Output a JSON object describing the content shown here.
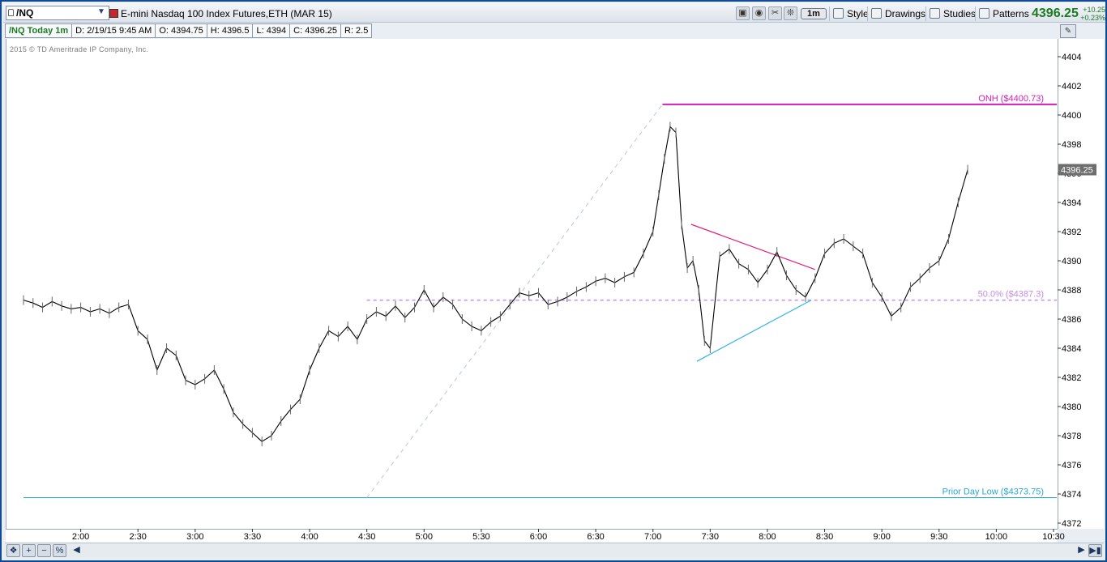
{
  "toolbar": {
    "symbol": "/NQ",
    "instrument": "E-mini Nasdaq 100 Index Futures,ETH (MAR 15)",
    "timeframe": "1m",
    "style_label": "Style",
    "drawings_label": "Drawings",
    "studies_label": "Studies",
    "patterns_label": "Patterns",
    "last_price": "4396.25",
    "change_abs": "+10.25",
    "change_pct": "+0.23%"
  },
  "infobar": {
    "title": "/NQ Today 1m",
    "date": "D: 2/19/15 9:45 AM",
    "open": "O: 4394.75",
    "high": "H: 4396.5",
    "low": "L: 4394",
    "close": "C: 4396.25",
    "range": "R: 2.5"
  },
  "copyright": "2015 © TD Ameritrade IP Company, Inc.",
  "colors": {
    "onh": "#d21fb6",
    "fib": "#c48be0",
    "prior_low": "#28a8d8",
    "triangle_top": "#e0207f",
    "triangle_bottom": "#33b5e5",
    "price_bars": "#000000",
    "price_green": "#1b7a23"
  },
  "chart_data": {
    "type": "line",
    "title": "",
    "xlabel": "",
    "ylabel": "",
    "ylim": [
      4371,
      4405
    ],
    "xlim": [
      "1:30",
      "10:30"
    ],
    "x_ticks": [
      "2:00",
      "2:30",
      "3:00",
      "3:30",
      "4:00",
      "4:30",
      "5:00",
      "5:30",
      "6:00",
      "6:30",
      "7:00",
      "7:30",
      "8:00",
      "8:30",
      "9:00",
      "9:30",
      "10:00",
      "10:30"
    ],
    "y_ticks": [
      4372,
      4374,
      4376,
      4378,
      4380,
      4382,
      4384,
      4386,
      4388,
      4390,
      4392,
      4394,
      4396,
      4398,
      4400,
      4402,
      4404
    ],
    "grid": false,
    "current_price_label": "4396.25",
    "levels": [
      {
        "label": "ONH ($4400.73)",
        "value": 4400.73,
        "start": "7:05"
      },
      {
        "label": "50.0%  ($4387.3)",
        "value": 4387.3,
        "start": "4:30"
      },
      {
        "label": "Prior Day Low ($4373.75)",
        "value": 4373.75,
        "start": "1:30"
      }
    ],
    "series": [
      {
        "x": [
          "1:30",
          "1:35",
          "1:40",
          "1:45",
          "1:50",
          "1:55",
          "2:00",
          "2:05",
          "2:10",
          "2:15",
          "2:20",
          "2:25",
          "2:30",
          "2:35",
          "2:40",
          "2:45",
          "2:50",
          "2:55",
          "3:00",
          "3:05",
          "3:10",
          "3:15",
          "3:20",
          "3:25",
          "3:30",
          "3:35",
          "3:40",
          "3:45",
          "3:50",
          "3:55",
          "4:00",
          "4:05",
          "4:10",
          "4:15",
          "4:20",
          "4:25",
          "4:30",
          "4:35",
          "4:40",
          "4:45",
          "4:50",
          "4:55",
          "5:00",
          "5:05",
          "5:10",
          "5:15",
          "5:20",
          "5:25",
          "5:30",
          "5:35",
          "5:40",
          "5:45",
          "5:50",
          "5:55",
          "6:00",
          "6:05",
          "6:10",
          "6:15",
          "6:20",
          "6:25",
          "6:30",
          "6:35",
          "6:40",
          "6:45",
          "6:50",
          "6:55",
          "7:00",
          "7:03",
          "7:06",
          "7:09",
          "7:12",
          "7:15",
          "7:18",
          "7:21",
          "7:24",
          "7:27",
          "7:30",
          "7:35",
          "7:40",
          "7:45",
          "7:50",
          "7:55",
          "8:00",
          "8:05",
          "8:10",
          "8:15",
          "8:20",
          "8:25",
          "8:30",
          "8:35",
          "8:40",
          "8:45",
          "8:50",
          "8:55",
          "9:00",
          "9:05",
          "9:10",
          "9:15",
          "9:20",
          "9:25",
          "9:30",
          "9:35",
          "9:40",
          "9:45"
        ],
        "values": [
          4387.3,
          4387.1,
          4386.8,
          4387.2,
          4386.9,
          4386.7,
          4386.8,
          4386.5,
          4386.7,
          4386.4,
          4386.8,
          4387.0,
          4385.2,
          4384.6,
          4382.5,
          4384.0,
          4383.5,
          4381.8,
          4381.5,
          4381.9,
          4382.5,
          4381.2,
          4379.6,
          4378.8,
          4378.2,
          4377.6,
          4378.0,
          4379.0,
          4379.8,
          4380.5,
          4382.5,
          4384.0,
          4385.2,
          4384.8,
          4385.5,
          4384.6,
          4386.0,
          4386.5,
          4386.2,
          4386.9,
          4386.1,
          4386.8,
          4388.0,
          4386.8,
          4387.5,
          4387.0,
          4386.0,
          4385.5,
          4385.2,
          4385.8,
          4386.2,
          4387.0,
          4387.8,
          4387.6,
          4387.8,
          4387.0,
          4387.2,
          4387.5,
          4387.9,
          4388.2,
          4388.6,
          4388.8,
          4388.5,
          4388.9,
          4389.2,
          4390.5,
          4392.0,
          4394.5,
          4397.0,
          4399.2,
          4398.8,
          4392.5,
          4389.5,
          4390.0,
          4388.0,
          4384.5,
          4384.0,
          4390.3,
          4390.8,
          4389.8,
          4389.4,
          4388.5,
          4389.4,
          4390.6,
          4389.0,
          4388.0,
          4387.5,
          4388.8,
          4390.5,
          4391.2,
          4391.5,
          4391.0,
          4390.5,
          4388.5,
          4387.5,
          4386.2,
          4386.8,
          4388.2,
          4388.8,
          4389.5,
          4390.0,
          4391.5,
          4394.0,
          4396.25
        ]
      }
    ]
  }
}
